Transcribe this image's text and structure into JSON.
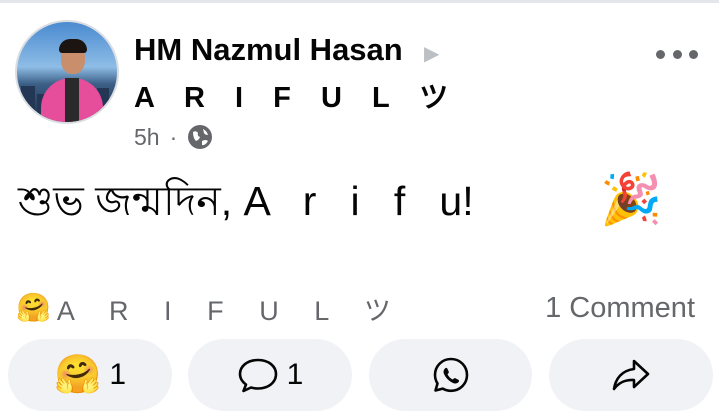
{
  "post": {
    "author": "HM Nazmul Hasan",
    "target": "A R I F U L ツ",
    "time": "5h",
    "separator": "·",
    "visibility_icon": "globe-icon",
    "body_text": "শুভ জন্মদিন, A   r   i   f   u!",
    "body_emoji": "🎉"
  },
  "reactions": {
    "icon": "🤗",
    "names": "A R I F U L ツ",
    "comments": "1 Comment"
  },
  "actions": {
    "react_emoji": "🤗",
    "react_count": "1",
    "comment_count": "1"
  },
  "colors": {
    "secondary_text": "#65676b",
    "button_bg": "#f0f2f5",
    "divider": "#e4e6eb"
  }
}
